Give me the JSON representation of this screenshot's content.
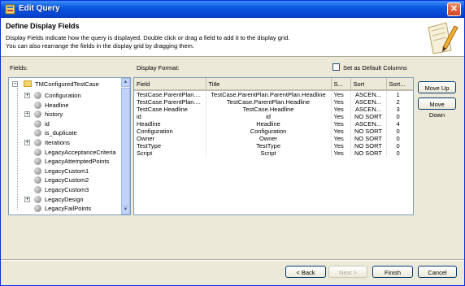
{
  "window": {
    "title": "Edit Query"
  },
  "header": {
    "title": "Define Display Fields",
    "desc_line1": "Display Fields indicate how the query is displayed. Double click or drag a field to add it to the display grid.",
    "desc_line2": "You can also rearrange the fields in the display grid by dragging them."
  },
  "fields_label": "Fields:",
  "display_format_label": "Display Format:",
  "default_columns_label": "Set as Default Columns",
  "tree": {
    "root": "TMConfiguredTestCase",
    "items": [
      {
        "label": "Configuration",
        "expandable": true
      },
      {
        "label": "Headline",
        "expandable": false
      },
      {
        "label": "history",
        "expandable": true
      },
      {
        "label": "id",
        "expandable": false
      },
      {
        "label": "is_duplicate",
        "expandable": false
      },
      {
        "label": "Iterations",
        "expandable": true
      },
      {
        "label": "LegacyAcceptanceCriteria",
        "expandable": false
      },
      {
        "label": "LegacyAttemptedPoints",
        "expandable": false
      },
      {
        "label": "LegacyCustom1",
        "expandable": false
      },
      {
        "label": "LegacyCustom2",
        "expandable": false
      },
      {
        "label": "LegacyCustom3",
        "expandable": false
      },
      {
        "label": "LegacyDesign",
        "expandable": true
      },
      {
        "label": "LegacyFailPoints",
        "expandable": false
      }
    ]
  },
  "grid": {
    "headers": [
      "Field",
      "Title",
      "S...",
      "Sort",
      "Sort..."
    ],
    "rows": [
      [
        "TestCase.ParentPlan....",
        "TestCase.ParentPlan.ParentPlan.Headline",
        "Yes",
        "ASCEN...",
        "1"
      ],
      [
        "TestCase.ParentPlan....",
        "TestCase.ParentPlan.Headline",
        "Yes",
        "ASCEN...",
        "2"
      ],
      [
        "TestCase.Headline",
        "TestCase.Headline",
        "Yes",
        "ASCEN...",
        "3"
      ],
      [
        "id",
        "id",
        "Yes",
        "NO SORT",
        "0"
      ],
      [
        "Headline",
        "Headline",
        "Yes",
        "ASCEN...",
        "4"
      ],
      [
        "Configuration",
        "Configuration",
        "Yes",
        "NO SORT",
        "0"
      ],
      [
        "Owner",
        "Owner",
        "Yes",
        "NO SORT",
        "0"
      ],
      [
        "TestType",
        "TestType",
        "Yes",
        "NO SORT",
        "0"
      ],
      [
        "Script",
        "Script",
        "Yes",
        "NO SORT",
        "0"
      ]
    ]
  },
  "buttons": {
    "move_up": "Move Up",
    "move_down": "Move Down",
    "back": "< Back",
    "next": "Next >",
    "finish": "Finish",
    "cancel": "Cancel"
  }
}
